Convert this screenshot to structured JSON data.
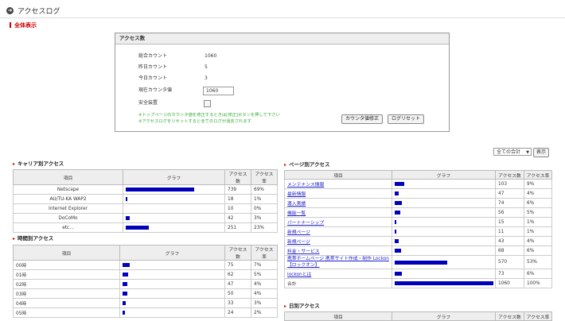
{
  "header": {
    "icon": "arrow-right-circle-icon",
    "title": "アクセスログ"
  },
  "sub_title": "全体表示",
  "access_count": {
    "title": "アクセス数",
    "rows": [
      {
        "label": "総合カウント",
        "value": "1060"
      },
      {
        "label": "昨日カウント",
        "value": "5"
      },
      {
        "label": "今日カウント",
        "value": "3"
      }
    ],
    "current_label": "現在カウンタ値",
    "current_value": "1060",
    "safety_label": "安全装置",
    "note1": "※トップページのカウンタ値を修正するときは[修正]ボタンを押して下さい",
    "note2": "※アクセスログをリセットすると全てのログが消去されます",
    "fix_button": "カウンタ値修正",
    "reset_button": "ログリセット"
  },
  "total_select": "全ての合計",
  "show_button": "表示",
  "carrier": {
    "title": "キャリア別アクセス",
    "headers": [
      "項目",
      "グラフ",
      "アクセス数",
      "アクセス率"
    ],
    "rows": [
      {
        "name": "Netscape",
        "count": "739",
        "rate": "69%",
        "frac": 0.69
      },
      {
        "name": "AU/TU-KA WAP2",
        "count": "18",
        "rate": "1%",
        "frac": 0.017
      },
      {
        "name": "Internet Explorer",
        "count": "10",
        "rate": "0%",
        "frac": 0.0
      },
      {
        "name": "DoCoMo",
        "count": "42",
        "rate": "3%",
        "frac": 0.04
      },
      {
        "name": "etc...",
        "count": "251",
        "rate": "23%",
        "frac": 0.23
      }
    ]
  },
  "hourly": {
    "title": "時間別アクセス",
    "headers": [
      "項目",
      "グラフ",
      "アクセス数",
      "アクセス率"
    ],
    "rows": [
      {
        "name": "00時",
        "count": "75",
        "rate": "7%",
        "frac": 0.07
      },
      {
        "name": "01時",
        "count": "62",
        "rate": "5%",
        "frac": 0.058
      },
      {
        "name": "02時",
        "count": "47",
        "rate": "4%",
        "frac": 0.044
      },
      {
        "name": "03時",
        "count": "50",
        "rate": "4%",
        "frac": 0.047
      },
      {
        "name": "04時",
        "count": "33",
        "rate": "3%",
        "frac": 0.031
      },
      {
        "name": "05時",
        "count": "24",
        "rate": "2%",
        "frac": 0.023
      }
    ]
  },
  "page": {
    "title": "ページ別アクセス",
    "headers": [
      "項目",
      "グラフ",
      "アクセス数",
      "アクセス率"
    ],
    "rows": [
      {
        "name": "メンテナンス情報",
        "count": "103",
        "rate": "9%",
        "frac": 0.097,
        "link": true
      },
      {
        "name": "最新情報",
        "count": "47",
        "rate": "4%",
        "frac": 0.044,
        "link": true
      },
      {
        "name": "導入実績",
        "count": "74",
        "rate": "6%",
        "frac": 0.07,
        "link": true
      },
      {
        "name": "機能一覧",
        "count": "56",
        "rate": "5%",
        "frac": 0.053,
        "link": true
      },
      {
        "name": "パートナーシップ",
        "count": "15",
        "rate": "1%",
        "frac": 0.014,
        "link": true
      },
      {
        "name": "新規ページ",
        "count": "11",
        "rate": "1%",
        "frac": 0.01,
        "link": true
      },
      {
        "name": "新規ページ",
        "count": "43",
        "rate": "4%",
        "frac": 0.04,
        "link": true
      },
      {
        "name": "料金・サービス",
        "count": "68",
        "rate": "6%",
        "frac": 0.064,
        "link": true
      },
      {
        "name": "携帯ホームページ 携帯サイト作成・制作 Lockon【ロックオン】",
        "count": "570",
        "rate": "53%",
        "frac": 0.53,
        "link": true,
        "tall": true
      },
      {
        "name": "lockonとは",
        "count": "73",
        "rate": "6%",
        "frac": 0.069,
        "link": true
      },
      {
        "name": "合計",
        "count": "1060",
        "rate": "100%",
        "frac": 1.0,
        "link": false
      }
    ]
  },
  "daily": {
    "title": "日別アクセス",
    "headers": [
      "項目",
      "グラフ",
      "アクセス数",
      "アクセス率"
    ]
  },
  "colors": {
    "bar": "#0000bb",
    "accent": "#cc0000",
    "note": "#33aa33"
  }
}
